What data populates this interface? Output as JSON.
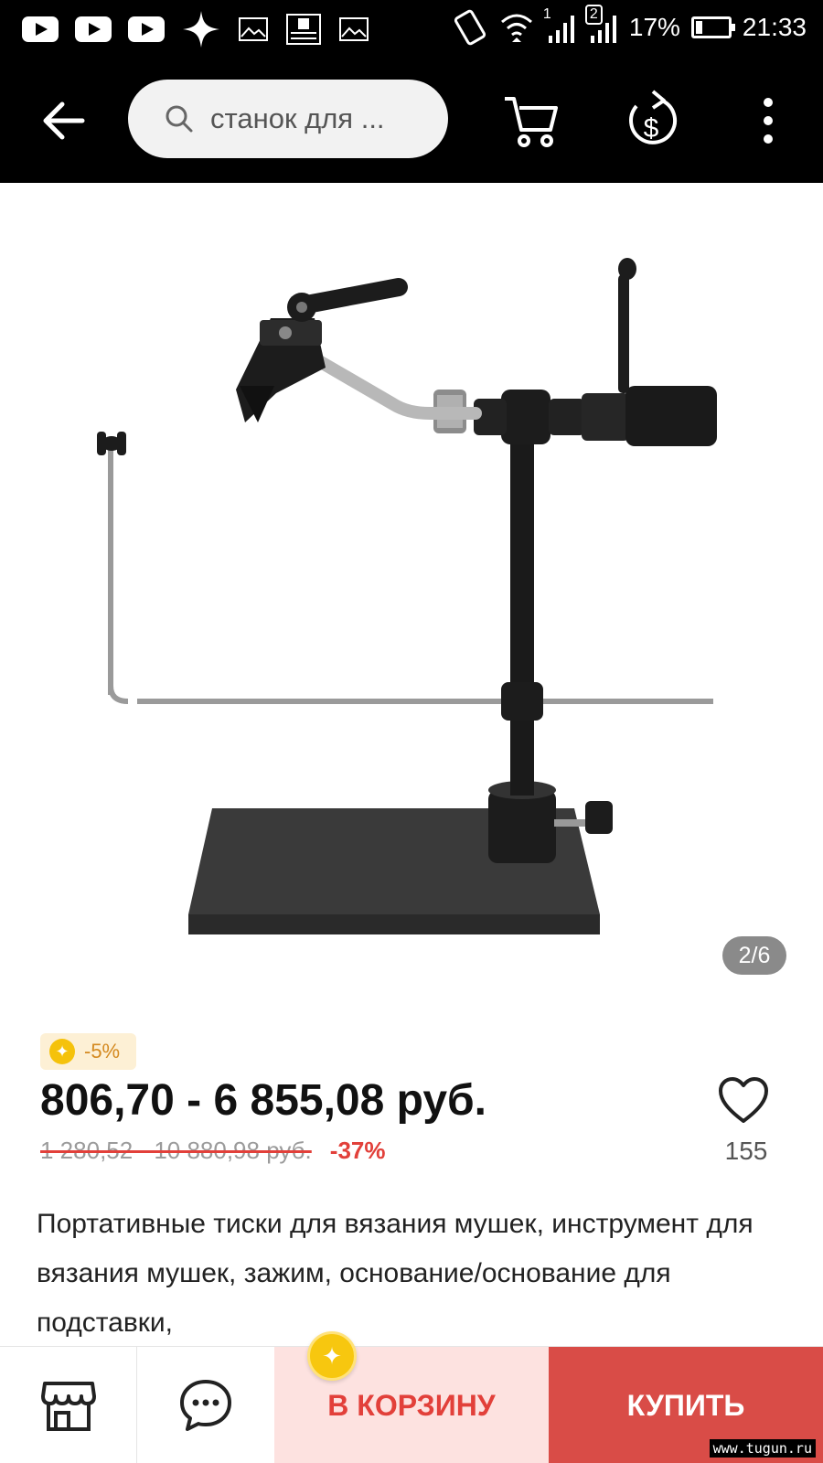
{
  "status_bar": {
    "signal_1": "1",
    "signal_2": "2",
    "battery": "17%",
    "time": "21:33"
  },
  "header": {
    "search_text": "станок для ...",
    "icons": [
      "back-arrow-icon",
      "search-icon",
      "cart-icon",
      "currency-icon",
      "more-icon"
    ]
  },
  "gallery": {
    "counter": "2/6"
  },
  "product": {
    "coin_badge": "-5%",
    "price": "806,70 - 6 855,08 руб.",
    "old_price": "1 280,52 - 10 880,98 руб.",
    "discount": "-37%",
    "favorites": "155",
    "description": "Портативные тиски для вязания мушек, инструмент для вязания мушек, зажим, основание/основание для подставки,"
  },
  "bottom_bar": {
    "add_to_cart": "В КОРЗИНУ",
    "buy": "КУПИТЬ"
  },
  "watermark": "www.tugun.ru",
  "colors": {
    "accent_red": "#e2403a",
    "buy_bg": "#d94c47",
    "cart_bg": "#fde2e0",
    "coin": "#f5c20b"
  }
}
